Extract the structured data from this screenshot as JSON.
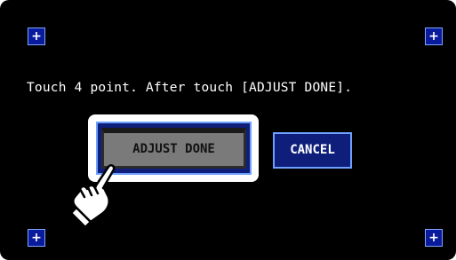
{
  "calibration_points": {
    "top_left": "+",
    "top_right": "+",
    "bottom_left": "+",
    "bottom_right": "+"
  },
  "instruction": "Touch 4 point. After touch [ADJUST DONE].",
  "buttons": {
    "adjust_done": "ADJUST DONE",
    "cancel": "CANCEL"
  },
  "colors": {
    "background": "#000000",
    "button_blue": "#0f1e7a",
    "button_border": "#6ea0ff",
    "adjust_face": "#7a7a7a"
  },
  "icons": {
    "pointer": "pointing-hand-icon"
  }
}
